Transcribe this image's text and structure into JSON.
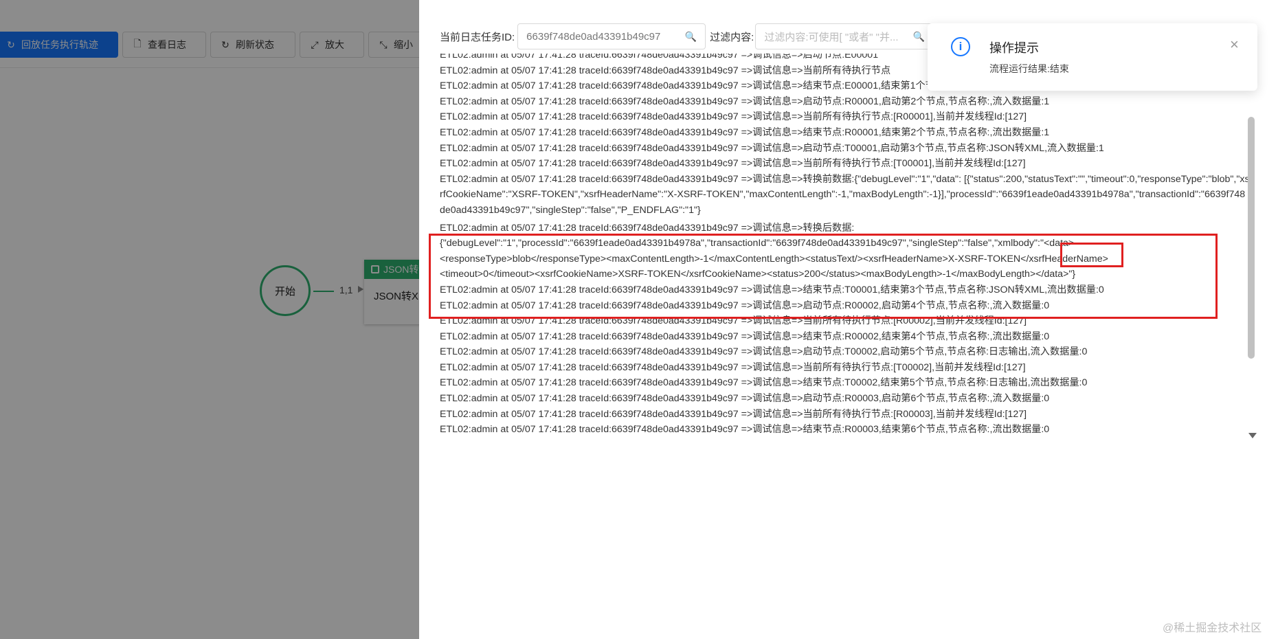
{
  "toolbar": {
    "buttons": [
      {
        "label": "回放任务执行轨迹",
        "icon": "replay-icon"
      },
      {
        "label": "查看日志",
        "icon": "file-icon"
      },
      {
        "label": "刷新状态",
        "icon": "refresh-icon"
      },
      {
        "label": "放大",
        "icon": "expand-icon"
      },
      {
        "label": "缩小",
        "icon": "shrink-icon"
      }
    ]
  },
  "canvas": {
    "start_node": "开始",
    "edge_label": "1,1",
    "json_node_head": "JSON转",
    "json_node_body": "JSON转X"
  },
  "filter": {
    "task_id_label": "当前日志任务ID:",
    "task_id_value": "6639f748de0ad43391b49c97",
    "content_label": "过滤内容:",
    "content_placeholder": "过滤内容:可使用[ \"或者\" \"并..."
  },
  "log": {
    "lines": [
      "ETL02:admin at 05/07 17:41:28 traceId:6639f748de0ad43391b49c97 =>调试信息=>启动节点:E00001",
      "ETL02:admin at 05/07 17:41:28 traceId:6639f748de0ad43391b49c97 =>调试信息=>当前所有待执行节点",
      "ETL02:admin at 05/07 17:41:28 traceId:6639f748de0ad43391b49c97 =>调试信息=>结束节点:E00001,结束第1个节点,节点名称:开始,流出数据量:1",
      "ETL02:admin at 05/07 17:41:28 traceId:6639f748de0ad43391b49c97 =>调试信息=>启动节点:R00001,启动第2个节点,节点名称:,流入数据量:1",
      "ETL02:admin at 05/07 17:41:28 traceId:6639f748de0ad43391b49c97 =>调试信息=>当前所有待执行节点:[R00001],当前并发线程Id:[127]",
      "ETL02:admin at 05/07 17:41:28 traceId:6639f748de0ad43391b49c97 =>调试信息=>结束节点:R00001,结束第2个节点,节点名称:,流出数据量:1",
      "ETL02:admin at 05/07 17:41:28 traceId:6639f748de0ad43391b49c97 =>调试信息=>启动节点:T00001,启动第3个节点,节点名称:JSON转XML,流入数据量:1",
      "ETL02:admin at 05/07 17:41:28 traceId:6639f748de0ad43391b49c97 =>调试信息=>当前所有待执行节点:[T00001],当前并发线程Id:[127]"
    ],
    "before_convert": "ETL02:admin at 05/07 17:41:28 traceId:6639f748de0ad43391b49c97 =>调试信息=>转换前数据:{\"debugLevel\":\"1\",\"data\": [{\"status\":200,\"statusText\":\"\",\"timeout\":0,\"responseType\":\"blob\",\"xsrfCookieName\":\"XSRF-TOKEN\",\"xsrfHeaderName\":\"X-XSRF-TOKEN\",\"maxContentLength\":-1,\"maxBodyLength\":-1}],\"processId\":\"6639f1eade0ad43391b4978a\",\"transactionId\":\"6639f748de0ad43391b49c97\",\"singleStep\":\"false\",\"P_ENDFLAG\":\"1\"}",
    "after_convert": {
      "line1": "ETL02:admin at 05/07 17:41:28 traceId:6639f748de0ad43391b49c97 =>调试信息=>转换后数据:",
      "line2": "{\"debugLevel\":\"1\",\"processId\":\"6639f1eade0ad43391b4978a\",\"transactionId\":\"6639f748de0ad43391b49c97\",\"singleStep\":\"false\",\"xmlbody\":\"<data>",
      "line3": "<responseType>blob</responseType><maxContentLength>-1</maxContentLength><statusText/><xsrfHeaderName>X-XSRF-TOKEN</xsrfHeaderName>",
      "line4": "<timeout>0</timeout><xsrfCookieName>XSRF-TOKEN</xsrfCookieName><status>200</status><maxBodyLength>-1</maxBodyLength></data>\"}",
      "line5": "ETL02:admin at 05/07 17:41:28 traceId:6639f748de0ad43391b49c97 =>调试信息=>结束节点:T00001,结束第3个节点,节点名称:JSON转XML,流出数据量:0"
    },
    "lines_after": [
      "ETL02:admin at 05/07 17:41:28 traceId:6639f748de0ad43391b49c97 =>调试信息=>启动节点:R00002,启动第4个节点,节点名称:,流入数据量:0",
      "ETL02:admin at 05/07 17:41:28 traceId:6639f748de0ad43391b49c97 =>调试信息=>当前所有待执行节点:[R00002],当前并发线程Id:[127]",
      "ETL02:admin at 05/07 17:41:28 traceId:6639f748de0ad43391b49c97 =>调试信息=>结束节点:R00002,结束第4个节点,节点名称:,流出数据量:0",
      "ETL02:admin at 05/07 17:41:28 traceId:6639f748de0ad43391b49c97 =>调试信息=>启动节点:T00002,启动第5个节点,节点名称:日志输出,流入数据量:0",
      "ETL02:admin at 05/07 17:41:28 traceId:6639f748de0ad43391b49c97 =>调试信息=>当前所有待执行节点:[T00002],当前并发线程Id:[127]",
      "ETL02:admin at 05/07 17:41:28 traceId:6639f748de0ad43391b49c97 =>调试信息=>结束节点:T00002,结束第5个节点,节点名称:日志输出,流出数据量:0",
      "ETL02:admin at 05/07 17:41:28 traceId:6639f748de0ad43391b49c97 =>调试信息=>启动节点:R00003,启动第6个节点,节点名称:,流入数据量:0",
      "ETL02:admin at 05/07 17:41:28 traceId:6639f748de0ad43391b49c97 =>调试信息=>当前所有待执行节点:[R00003],当前并发线程Id:[127]",
      "ETL02:admin at 05/07 17:41:28 traceId:6639f748de0ad43391b49c97 =>调试信息=>结束节点:R00003,结束第6个节点,节点名称:,流出数据量:0"
    ]
  },
  "notification": {
    "title": "操作提示",
    "message": "流程运行结果:结束",
    "icon": "info-icon"
  },
  "watermark": "@稀土掘金技术社区",
  "colors": {
    "primary": "#1677ff",
    "node_green": "#2fb170",
    "highlight_red": "#e02020"
  }
}
